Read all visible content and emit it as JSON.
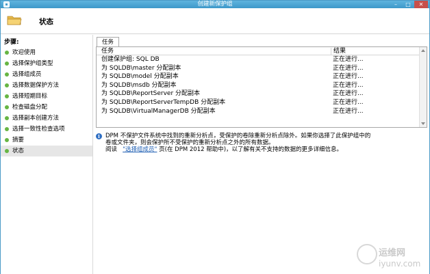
{
  "window": {
    "title": "创建新保护组"
  },
  "header": {
    "page_title": "状态"
  },
  "sidebar": {
    "steps_label": "步骤:",
    "items": [
      {
        "label": "欢迎使用"
      },
      {
        "label": "选择保护组类型"
      },
      {
        "label": "选择组成员"
      },
      {
        "label": "选择数据保护方法"
      },
      {
        "label": "选择短期目标"
      },
      {
        "label": "检查磁盘分配"
      },
      {
        "label": "选择副本创建方法"
      },
      {
        "label": "选择一致性检查选项"
      },
      {
        "label": "摘要"
      },
      {
        "label": "状态"
      }
    ],
    "active_index": 9
  },
  "tabs": {
    "task_tab": "任务"
  },
  "grid": {
    "columns": [
      "任务",
      "结果"
    ],
    "rows": [
      {
        "task": "创建保护组: SQL DB",
        "result": "正在进行..."
      },
      {
        "task": "为 SQLDB\\master 分配副本",
        "result": "正在进行..."
      },
      {
        "task": "为 SQLDB\\model 分配副本",
        "result": "正在进行..."
      },
      {
        "task": "为 SQLDB\\msdb 分配副本",
        "result": "正在进行..."
      },
      {
        "task": "为 SQLDB\\ReportServer 分配副本",
        "result": "正在进行..."
      },
      {
        "task": "为 SQLDB\\ReportServerTempDB 分配副本",
        "result": "正在进行..."
      },
      {
        "task": "为 SQLDB\\VirtualManagerDB 分配副本",
        "result": "正在进行..."
      }
    ]
  },
  "info": {
    "line1": "DPM 不保护文件系统中找到的重新分析点，受保护的卷除重新分析点除外。如果你选择了此保护组中的",
    "line2": "卷或文件夹，则会保护所不受保护的重新分析点之外的所有数据。",
    "line3_prefix": "阅读",
    "link": "\"选择组成员\"",
    "line3_suffix": "页(在 DPM 2012 帮助中)，以了解有关不支持的数据的更多详细信息。"
  },
  "watermark": {
    "text1": "运维网",
    "text2": "iyunv.com"
  },
  "colors": {
    "titlebar": "#3d98c9",
    "step_dot": "#67b543",
    "link": "#1f5fb3",
    "info_icon": "#2f6fc3"
  }
}
